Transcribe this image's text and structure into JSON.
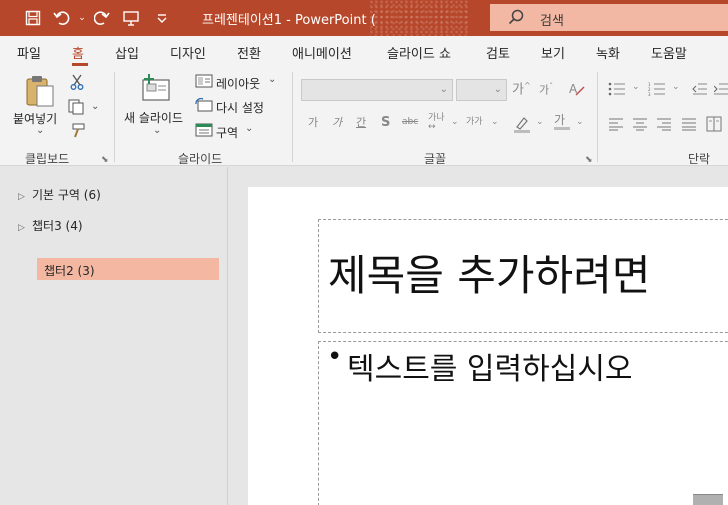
{
  "title_bar": {
    "document_title": "프레젠테이션1  -  PowerPoint (",
    "search_label": "검색",
    "quick_access": [
      "save-icon",
      "undo-icon",
      "redo-icon",
      "present-icon",
      "customize-icon"
    ]
  },
  "tabs": [
    "파일",
    "홈",
    "삽입",
    "디자인",
    "전환",
    "애니메이션",
    "슬라이드 쇼",
    "검토",
    "보기",
    "녹화",
    "도움말"
  ],
  "active_tab": "홈",
  "ribbon": {
    "clipboard": {
      "paste_label": "붙여넣기",
      "group_label": "클립보드"
    },
    "slides": {
      "new_slide_label": "새 슬라이드",
      "layout_label": "레이아웃",
      "reset_label": "다시 설정",
      "section_label": "구역",
      "group_label": "슬라이드"
    },
    "font": {
      "group_label": "글꼴",
      "grow_font": "가",
      "shrink_font": "가",
      "bold": "가",
      "italic": "가",
      "underline": "간",
      "shadow": "S",
      "strike": "abc",
      "spacing": "가나",
      "case": "가가",
      "color": "가"
    },
    "paragraph": {
      "group_label": "단락"
    }
  },
  "sections": [
    {
      "label": "기본 구역 (6)"
    },
    {
      "label": "챕터3 (4)"
    },
    {
      "label": "챕터2 (3)"
    }
  ],
  "slide": {
    "title_placeholder": "제목을 추가하려면",
    "body_placeholder": "텍스트를 입력하십시오"
  },
  "colors": {
    "accent": "#b7472a",
    "search_bg": "#f3b8a4",
    "selected_section": "#f4b8a2"
  }
}
